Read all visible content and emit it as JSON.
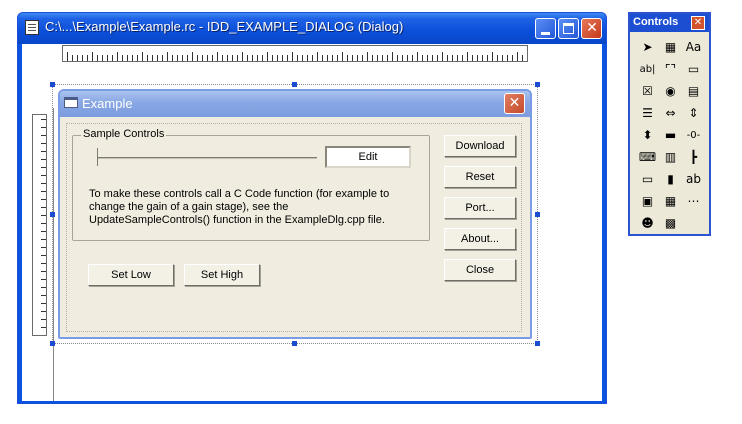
{
  "window": {
    "title": "C:\\...\\Example\\Example.rc - IDD_EXAMPLE_DIALOG (Dialog)"
  },
  "dialog": {
    "title": "Example",
    "group_label": "Sample Controls",
    "edit_value": "Edit",
    "description": "To make these controls call a C Code function (for example to change the gain of a gain stage), see the UpdateSampleControls() function in the ExampleDlg.cpp file.",
    "buttons": {
      "download": "Download",
      "reset": "Reset",
      "port": "Port...",
      "about": "About...",
      "close": "Close",
      "set_low": "Set Low",
      "set_high": "Set High"
    }
  },
  "toolbox": {
    "title": "Controls",
    "tools": [
      {
        "name": "pointer-tool",
        "glyph": "➤"
      },
      {
        "name": "picture-tool",
        "glyph": "▦"
      },
      {
        "name": "static-text-tool",
        "glyph": "Aa"
      },
      {
        "name": "edit-box-tool",
        "glyph": "ab|"
      },
      {
        "name": "group-box-tool",
        "glyph": "⌜⌝"
      },
      {
        "name": "button-tool",
        "glyph": "▭"
      },
      {
        "name": "check-box-tool",
        "glyph": "☒"
      },
      {
        "name": "radio-button-tool",
        "glyph": "◉"
      },
      {
        "name": "combo-box-tool",
        "glyph": "▤"
      },
      {
        "name": "list-box-tool",
        "glyph": "☰"
      },
      {
        "name": "horizontal-scrollbar-tool",
        "glyph": "⇔"
      },
      {
        "name": "vertical-scrollbar-tool",
        "glyph": "⇕"
      },
      {
        "name": "spin-tool",
        "glyph": "⬍"
      },
      {
        "name": "progress-tool",
        "glyph": "▬"
      },
      {
        "name": "slider-tool",
        "glyph": "-0-"
      },
      {
        "name": "hotkey-tool",
        "glyph": "⌨"
      },
      {
        "name": "list-control-tool",
        "glyph": "▥"
      },
      {
        "name": "tree-control-tool",
        "glyph": "┣"
      },
      {
        "name": "tab-control-tool",
        "glyph": "▭"
      },
      {
        "name": "animation-tool",
        "glyph": "▮"
      },
      {
        "name": "rich-edit-tool",
        "glyph": "ab"
      },
      {
        "name": "date-time-picker-tool",
        "glyph": "▣"
      },
      {
        "name": "month-calendar-tool",
        "glyph": "▦"
      },
      {
        "name": "ip-address-tool",
        "glyph": "⋯"
      },
      {
        "name": "custom-control-tool",
        "glyph": "☻"
      },
      {
        "name": "extended-combo-tool",
        "glyph": "▩"
      }
    ]
  }
}
